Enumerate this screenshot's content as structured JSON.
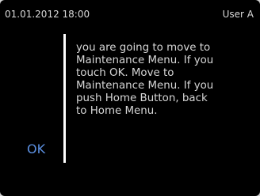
{
  "status_bar": {
    "datetime": "01.01.2012 18:00",
    "user": "User A"
  },
  "dialog": {
    "message": "you are going to move to\nMaintenance Menu. If you\ntouch OK. Move to\nMaintenance Menu. If you\npush Home Button, back\nto Home Menu.",
    "ok_label": "OK"
  },
  "colors": {
    "background": "#000000",
    "text": "#d6d6d6",
    "accent": "#5b8fe0",
    "divider": "#ffffff"
  }
}
